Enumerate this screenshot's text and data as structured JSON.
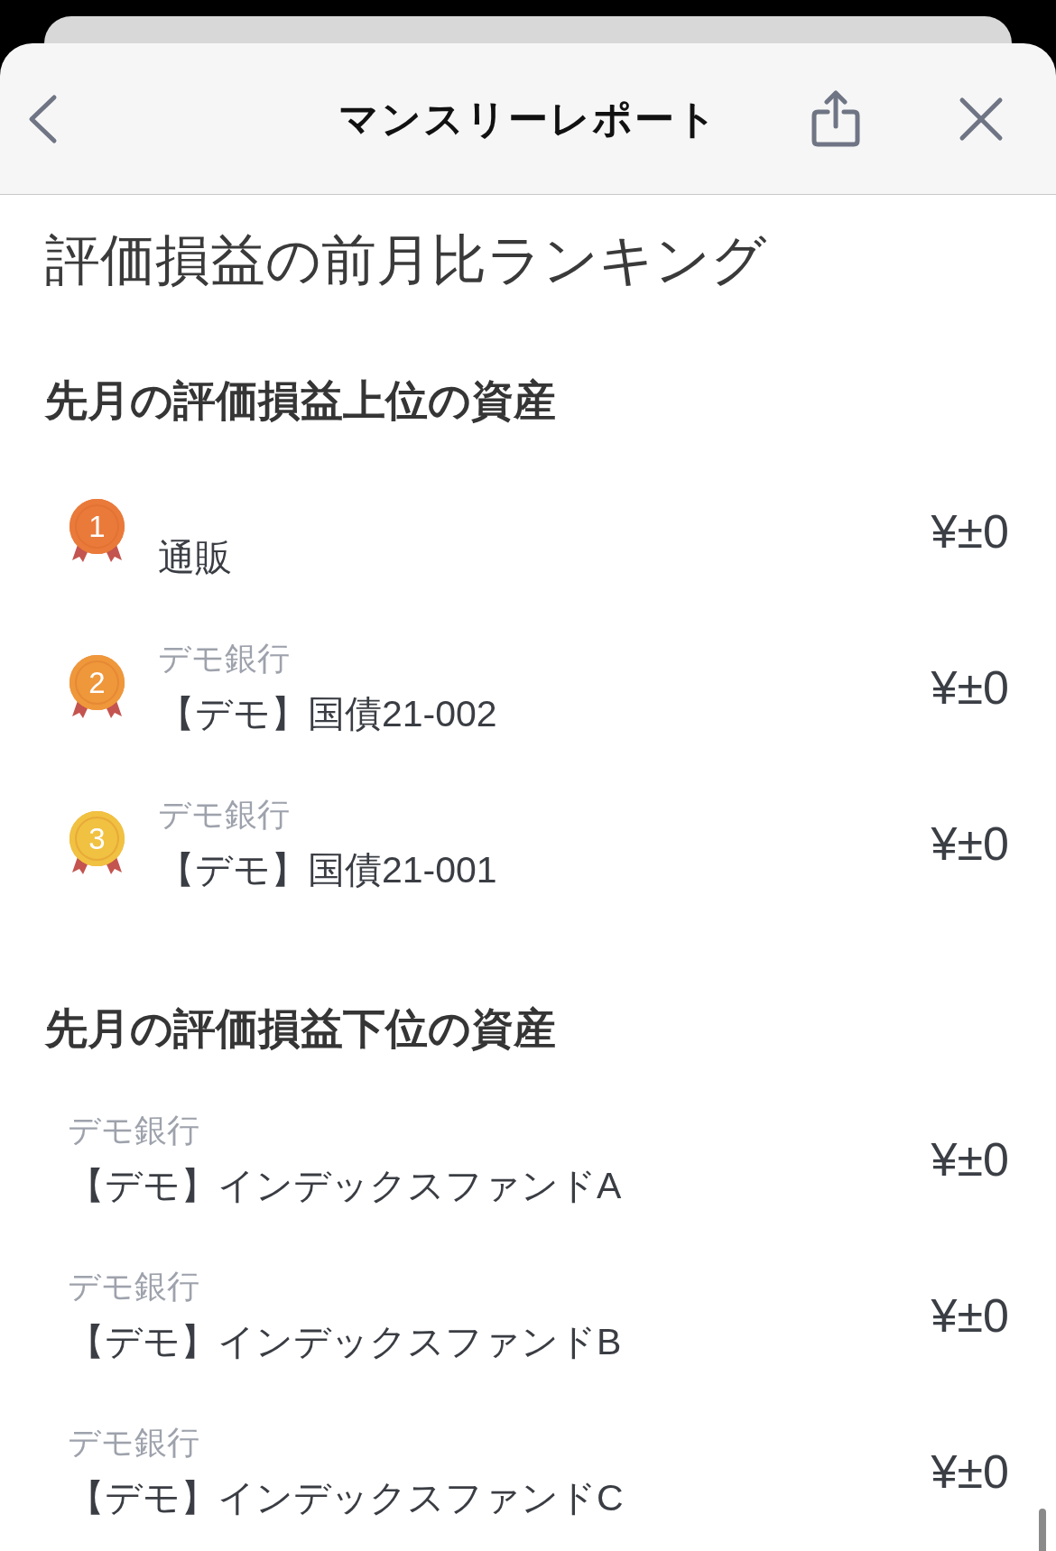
{
  "header": {
    "title": "マンスリーレポート"
  },
  "page_title": "評価損益の前月比ランキング",
  "sections": [
    {
      "heading": "先月の評価損益上位の資産",
      "items": [
        {
          "rank": "1",
          "color": "#ea7a3a",
          "name": "通販",
          "amount": "¥±0"
        },
        {
          "rank": "2",
          "color": "#ef973b",
          "institution": "デモ銀行",
          "name": "【デモ】国債21-002",
          "amount": "¥±0"
        },
        {
          "rank": "3",
          "color": "#f1c141",
          "institution": "デモ銀行",
          "name": "【デモ】国債21-001",
          "amount": "¥±0"
        }
      ]
    },
    {
      "heading": "先月の評価損益下位の資産",
      "items": [
        {
          "institution": "デモ銀行",
          "name": "【デモ】インデックスファンドA",
          "amount": "¥±0"
        },
        {
          "institution": "デモ銀行",
          "name": "【デモ】インデックスファンドB",
          "amount": "¥±0"
        },
        {
          "institution": "デモ銀行",
          "name": "【デモ】インデックスファンドC",
          "amount": "¥±0"
        }
      ]
    }
  ]
}
